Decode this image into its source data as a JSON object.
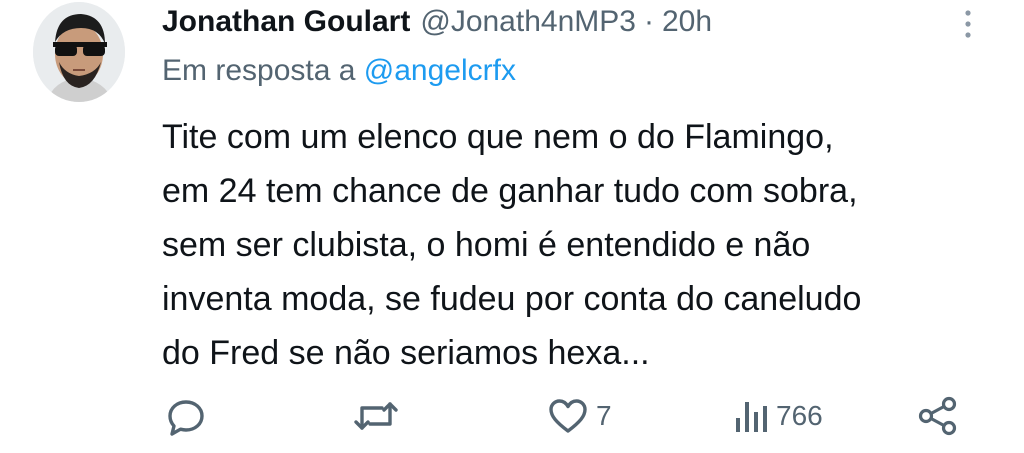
{
  "tweet": {
    "author_name": "Jonathan Goulart",
    "handle": "@Jonath4nMP3",
    "separator": "·",
    "time": "20h",
    "reply_prefix": "Em resposta a",
    "reply_to": "@angelcrfx",
    "lines": [
      "Tite com um elenco que nem o do Flamingo,",
      "em 24 tem chance de ganhar tudo com sobra,",
      "sem ser clubista, o homi é entendido e não",
      "inventa moda, se fudeu por conta do caneludo",
      "do Fred se não seriamos hexa..."
    ]
  },
  "actions": {
    "reply_icon": "reply-icon",
    "retweet_icon": "retweet-icon",
    "like_icon": "heart-icon",
    "like_count": "7",
    "views_icon": "views-icon",
    "views_count": "766",
    "share_icon": "share-icon"
  },
  "colors": {
    "text": "#0f1419",
    "secondary": "#536471",
    "link": "#1d9bf0",
    "background": "#ffffff"
  }
}
